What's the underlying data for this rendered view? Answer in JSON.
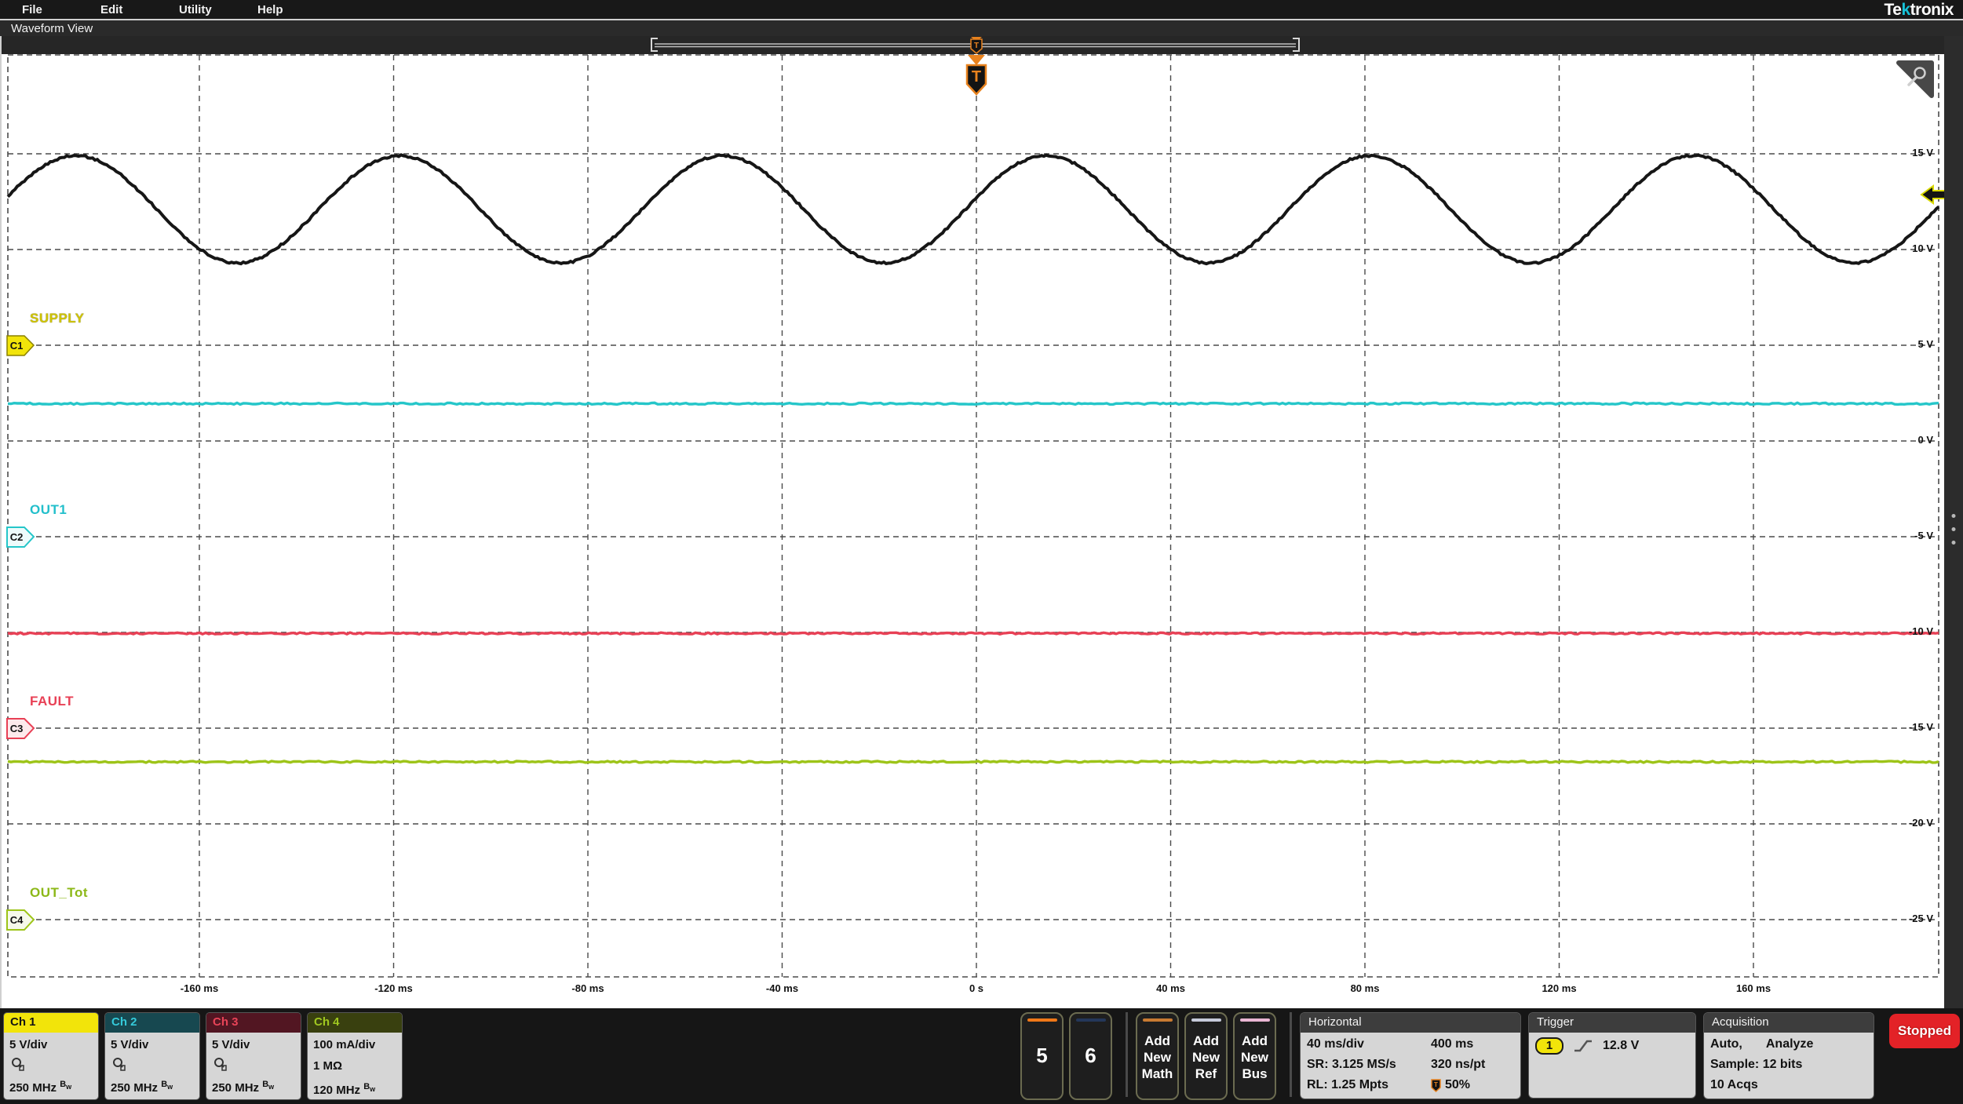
{
  "menu": {
    "items": [
      "File",
      "Edit",
      "Utility",
      "Help"
    ],
    "brand": {
      "pre": "Te",
      "k": "k",
      "post": "tronix"
    }
  },
  "view_title": "Waveform View",
  "chart_data": {
    "type": "line",
    "title": "Waveform View",
    "grid": true,
    "x_axis": {
      "unit": "time",
      "ms_per_div": 40,
      "ticks": [
        "-160 ms",
        "-120 ms",
        "-80 ms",
        "-40 ms",
        "0 s",
        "40 ms",
        "80 ms",
        "120 ms",
        "160 ms"
      ],
      "range_ms": [
        -200,
        200
      ]
    },
    "y_axis": {
      "volts_per_div": 5,
      "ticks": [
        "15 V",
        "10 V",
        "5 V",
        "0 V",
        "-5 V",
        "-10 V",
        "-15 V",
        "-20 V",
        "-25 V"
      ]
    },
    "series": [
      {
        "name": "SUPPLY",
        "channel": "C1",
        "color": "#161616",
        "shape": "sine",
        "mean_v": 12.1,
        "amplitude_v": 2.8,
        "period_ms": 66.6,
        "frequency_hz": 15,
        "peak_time_ms": -185.4,
        "min_v": 9.3,
        "max_v": 14.9,
        "ground_at_v": 5
      },
      {
        "name": "OUT1",
        "channel": "C2",
        "color": "#25c6c9",
        "shape": "flat",
        "axis_v": 1.95,
        "ground_at_v": -5
      },
      {
        "name": "FAULT",
        "channel": "C3",
        "color": "#e84055",
        "shape": "flat",
        "axis_v": -10.05,
        "ground_at_v": -15
      },
      {
        "name": "OUT_Tot",
        "channel": "C4",
        "color": "#9dc418",
        "shape": "flat",
        "axis_v": -16.76,
        "level_ma": 165,
        "ground_at_v": -25
      }
    ],
    "trigger": {
      "source": "1",
      "level": "12.8 V",
      "level_v": 12.8,
      "slope": "rising",
      "position_pct": 50
    }
  },
  "channels": [
    {
      "name": "Ch 1",
      "scale": "5 V/div",
      "bandwidth": "250 MHz"
    },
    {
      "name": "Ch 2",
      "scale": "5 V/div",
      "bandwidth": "250 MHz"
    },
    {
      "name": "Ch 3",
      "scale": "5 V/div",
      "bandwidth": "250 MHz"
    },
    {
      "name": "Ch 4",
      "scale": "100 mA/div",
      "impedance": "1 MΩ",
      "bandwidth": "120 MHz"
    }
  ],
  "labels": {
    "bw_b": "B",
    "bw_w": "w"
  },
  "scope_buttons": [
    {
      "label": "5",
      "bar_color": "#f07818"
    },
    {
      "label": "6",
      "bar_color": "#24375a"
    }
  ],
  "add_buttons": [
    {
      "lines": [
        "Add",
        "New",
        "Math"
      ],
      "bar_color": "#c87a32"
    },
    {
      "lines": [
        "Add",
        "New",
        "Ref"
      ],
      "bar_color": "#c6cada"
    },
    {
      "lines": [
        "Add",
        "New",
        "Bus"
      ],
      "bar_color": "#eab6d4"
    }
  ],
  "horizontal": {
    "title": "Horizontal",
    "rows": [
      [
        "40 ms/div",
        "400 ms"
      ],
      [
        "SR: 3.125 MS/s",
        "320 ns/pt"
      ],
      [
        "RL: 1.25 Mpts",
        "50%"
      ]
    ]
  },
  "trigger_panel": {
    "title": "Trigger",
    "source": "1",
    "level": "12.8 V"
  },
  "acquisition": {
    "title": "Acquisition",
    "mode": "Auto,",
    "analyze": "Analyze",
    "row2": "Sample: 12 bits",
    "row3": "10 Acqs"
  },
  "status": {
    "label": "Stopped",
    "color": "#e32227"
  }
}
